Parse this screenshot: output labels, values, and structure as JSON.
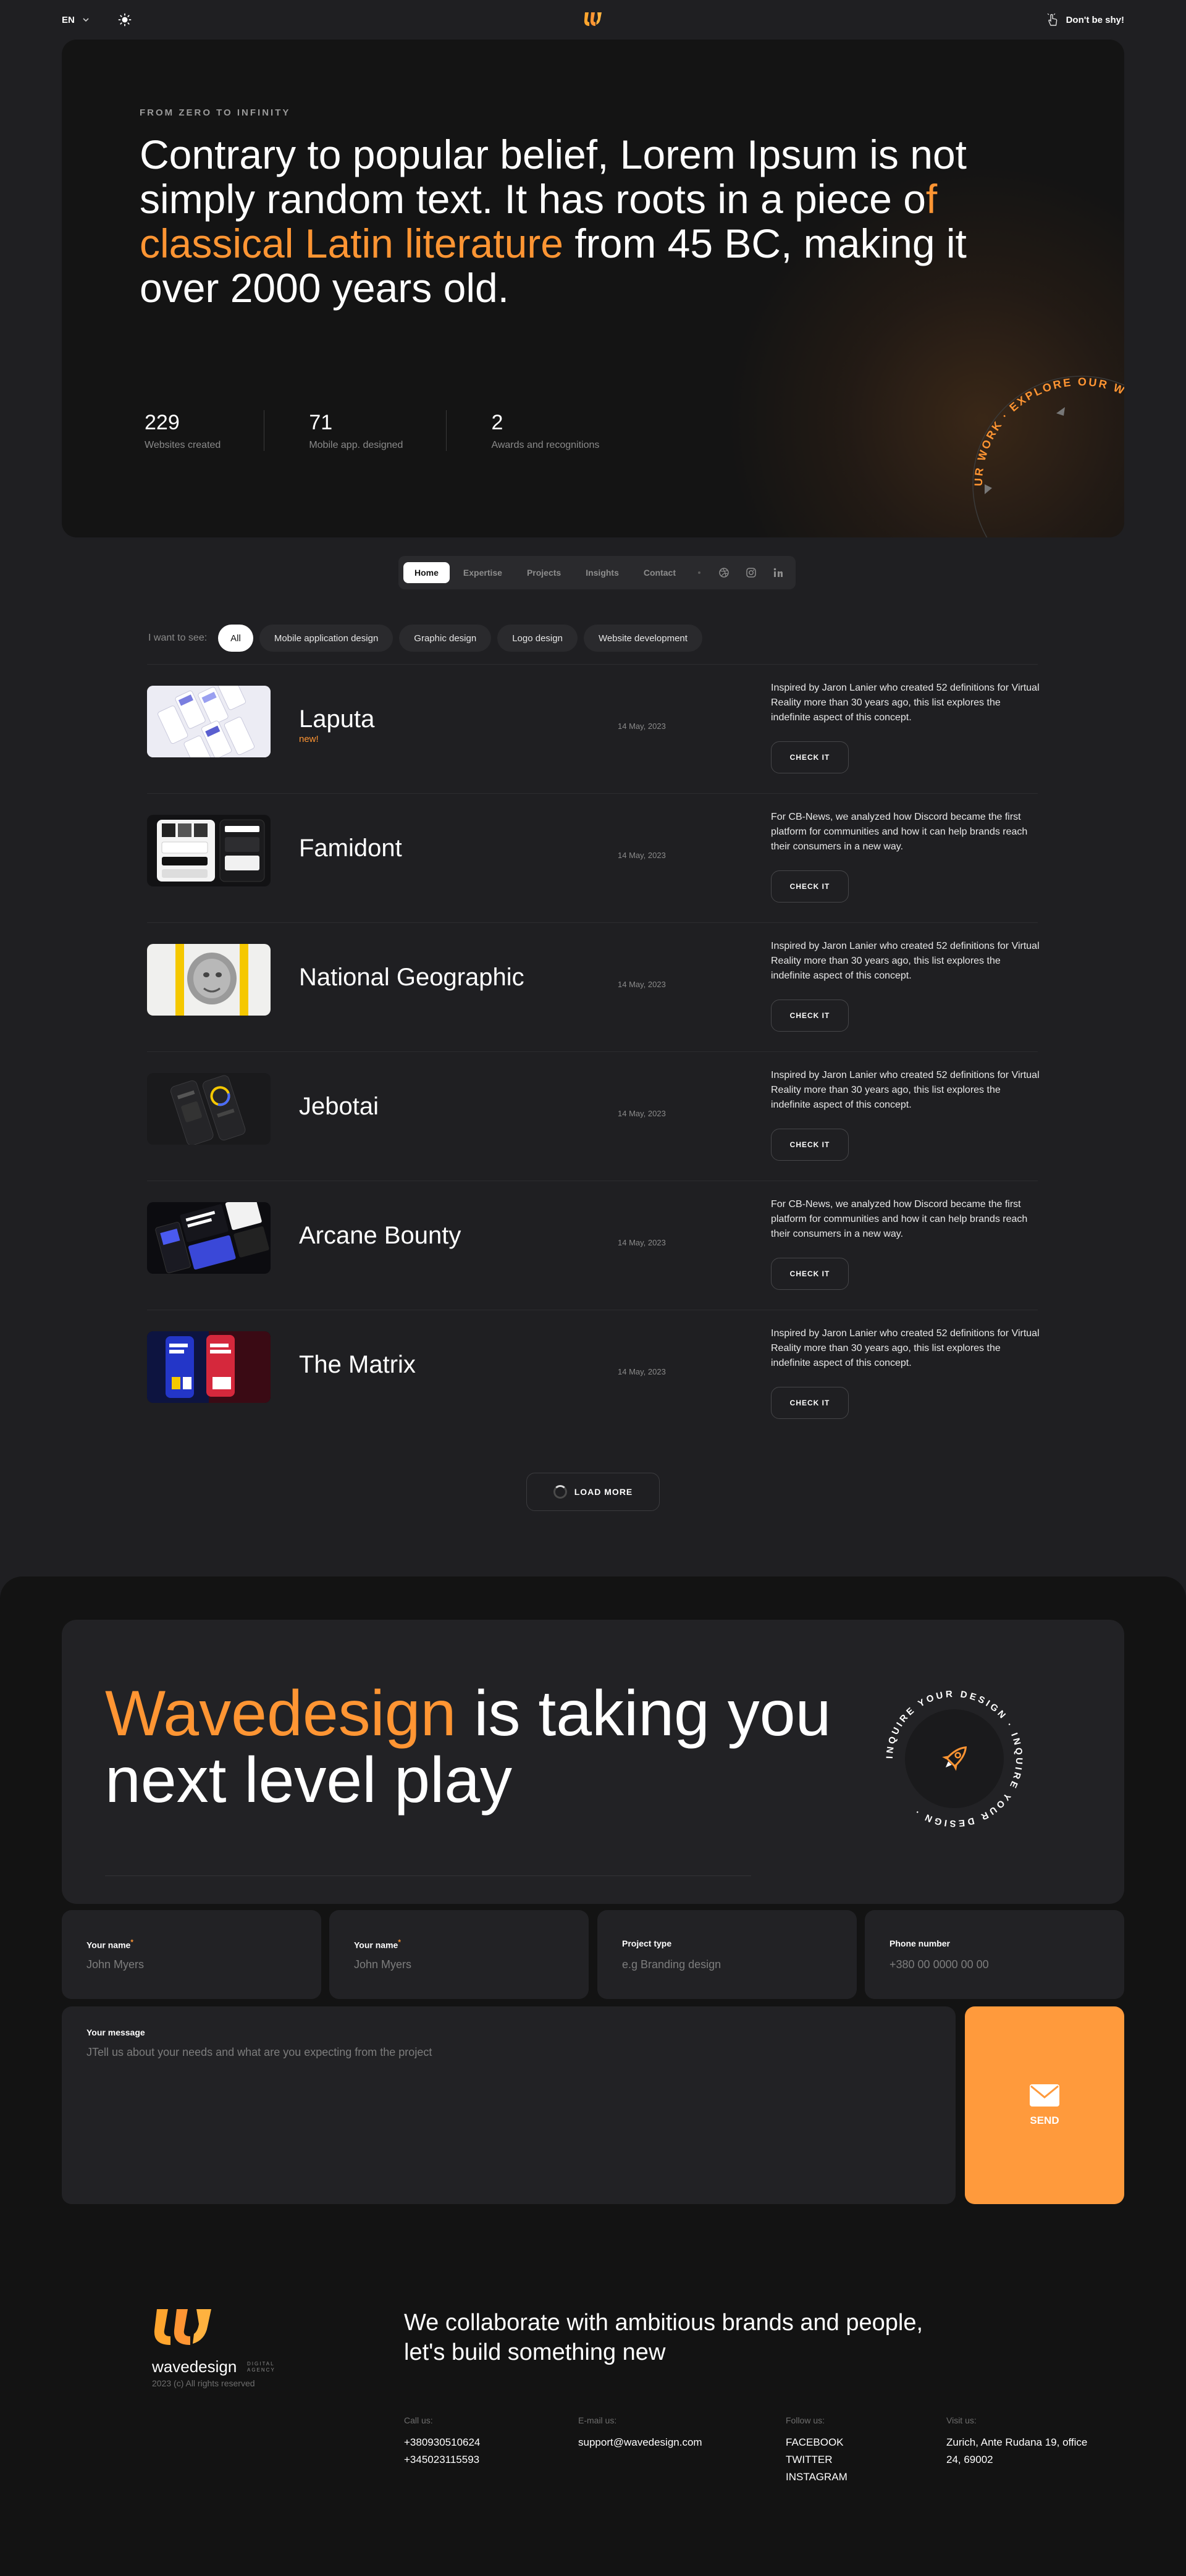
{
  "topbar": {
    "language": "EN",
    "contact_label": "Don't be shy!"
  },
  "hero": {
    "kicker": "FROM ZERO TO INFINITY",
    "headline_before": "Contrary to popular belief, Lorem Ipsum is not simply random text. It has roots in a piece o",
    "headline_highlight": "f classical Latin literature",
    "headline_after": " from 45 BC, making it over 2000 years old.",
    "circle_text": "OUR WORK · EXPLORE OUR WORK · EXPLORE OUR WORK ·",
    "stats": [
      {
        "value": "229",
        "label": "Websites created"
      },
      {
        "value": "71",
        "label": "Mobile app. designed"
      },
      {
        "value": "2",
        "label": "Awards and recognitions"
      }
    ]
  },
  "nav": {
    "items": [
      "Home",
      "Expertise",
      "Projects",
      "Insights",
      "Contact"
    ],
    "active": "Home",
    "social": [
      "dribbble-icon",
      "instagram-icon",
      "linkedin-icon"
    ]
  },
  "filters": {
    "label": "I want to see:",
    "chips": [
      "All",
      "Mobile application design",
      "Graphic design",
      "Logo design",
      "Website development"
    ]
  },
  "projects": [
    {
      "title": "Laputa",
      "badge": "new!",
      "date": "14 May, 2023",
      "desc": "Inspired by Jaron Lanier who created 52 definitions for Virtual Reality more than 30 years ago, this list explores the indefinite aspect of this concept.",
      "button": "CHECK IT"
    },
    {
      "title": "Famidont",
      "badge": "",
      "date": "14 May, 2023",
      "desc": "For CB-News, we analyzed how Discord became the first platform for communities and how it can help brands reach their consumers in a new way.",
      "button": "CHECK IT"
    },
    {
      "title": "National Geographic",
      "badge": "",
      "date": "14 May, 2023",
      "desc": "Inspired by Jaron Lanier who created 52 definitions for Virtual Reality more than 30 years ago, this list explores the indefinite aspect of this concept.",
      "button": "CHECK IT"
    },
    {
      "title": "Jebotai",
      "badge": "",
      "date": "14 May, 2023",
      "desc": "Inspired by Jaron Lanier who created 52 definitions for Virtual Reality more than 30 years ago, this list explores the indefinite aspect of this concept.",
      "button": "CHECK IT"
    },
    {
      "title": "Arcane Bounty",
      "badge": "",
      "date": "14 May, 2023",
      "desc": "For CB-News, we analyzed how Discord became the first platform for communities and how it can help brands reach their consumers in a new way.",
      "button": "CHECK IT"
    },
    {
      "title": "The Matrix",
      "badge": "",
      "date": "14 May, 2023",
      "desc": "Inspired by Jaron Lanier who created 52 definitions for Virtual Reality more than 30 years ago, this list explores the indefinite aspect of this concept.",
      "button": "CHECK IT"
    }
  ],
  "load_more": "LOAD MORE",
  "cta": {
    "title_highlight": "Wavedesign",
    "title_rest": " is taking you next level play",
    "badge_text": "INQUIRE YOUR DESIGN · INQUIRE YOUR DESIGN ·"
  },
  "form": {
    "fields": [
      {
        "label": "Your name",
        "required": true,
        "placeholder": "John Myers"
      },
      {
        "label": "Your name",
        "required": true,
        "placeholder": "John Myers"
      },
      {
        "label": "Project type",
        "required": false,
        "placeholder": "e.g Branding design"
      },
      {
        "label": "Phone number",
        "required": false,
        "placeholder": "+380 00 0000 00 00"
      }
    ],
    "message_label": "Your message",
    "message_placeholder": "JTell us about your needs and what are you expecting from the project",
    "send_label": "SEND",
    "required_mark": "*"
  },
  "footer": {
    "brand": "wavedesign",
    "brand_sub_1": "DIGITAL",
    "brand_sub_2": "AGENCY",
    "copyright": "2023 (c) All rights reserved",
    "title": "We collaborate with ambitious brands and people, let's build something new",
    "call_label": "Call us:",
    "phones": [
      "+380930510624",
      "+345023115593"
    ],
    "email_label": "E-mail us:",
    "email": "support@wavedesign.com",
    "follow_label": "Follow us:",
    "social": [
      "FACEBOOK",
      "TWITTER",
      "INSTAGRAM"
    ],
    "visit_label": "Visit us:",
    "address": "Zurich, Ante Rudana 19, office 24, 69002"
  },
  "colors": {
    "accent": "#ff9533",
    "background": "#1f1f22",
    "card": "#222225"
  }
}
